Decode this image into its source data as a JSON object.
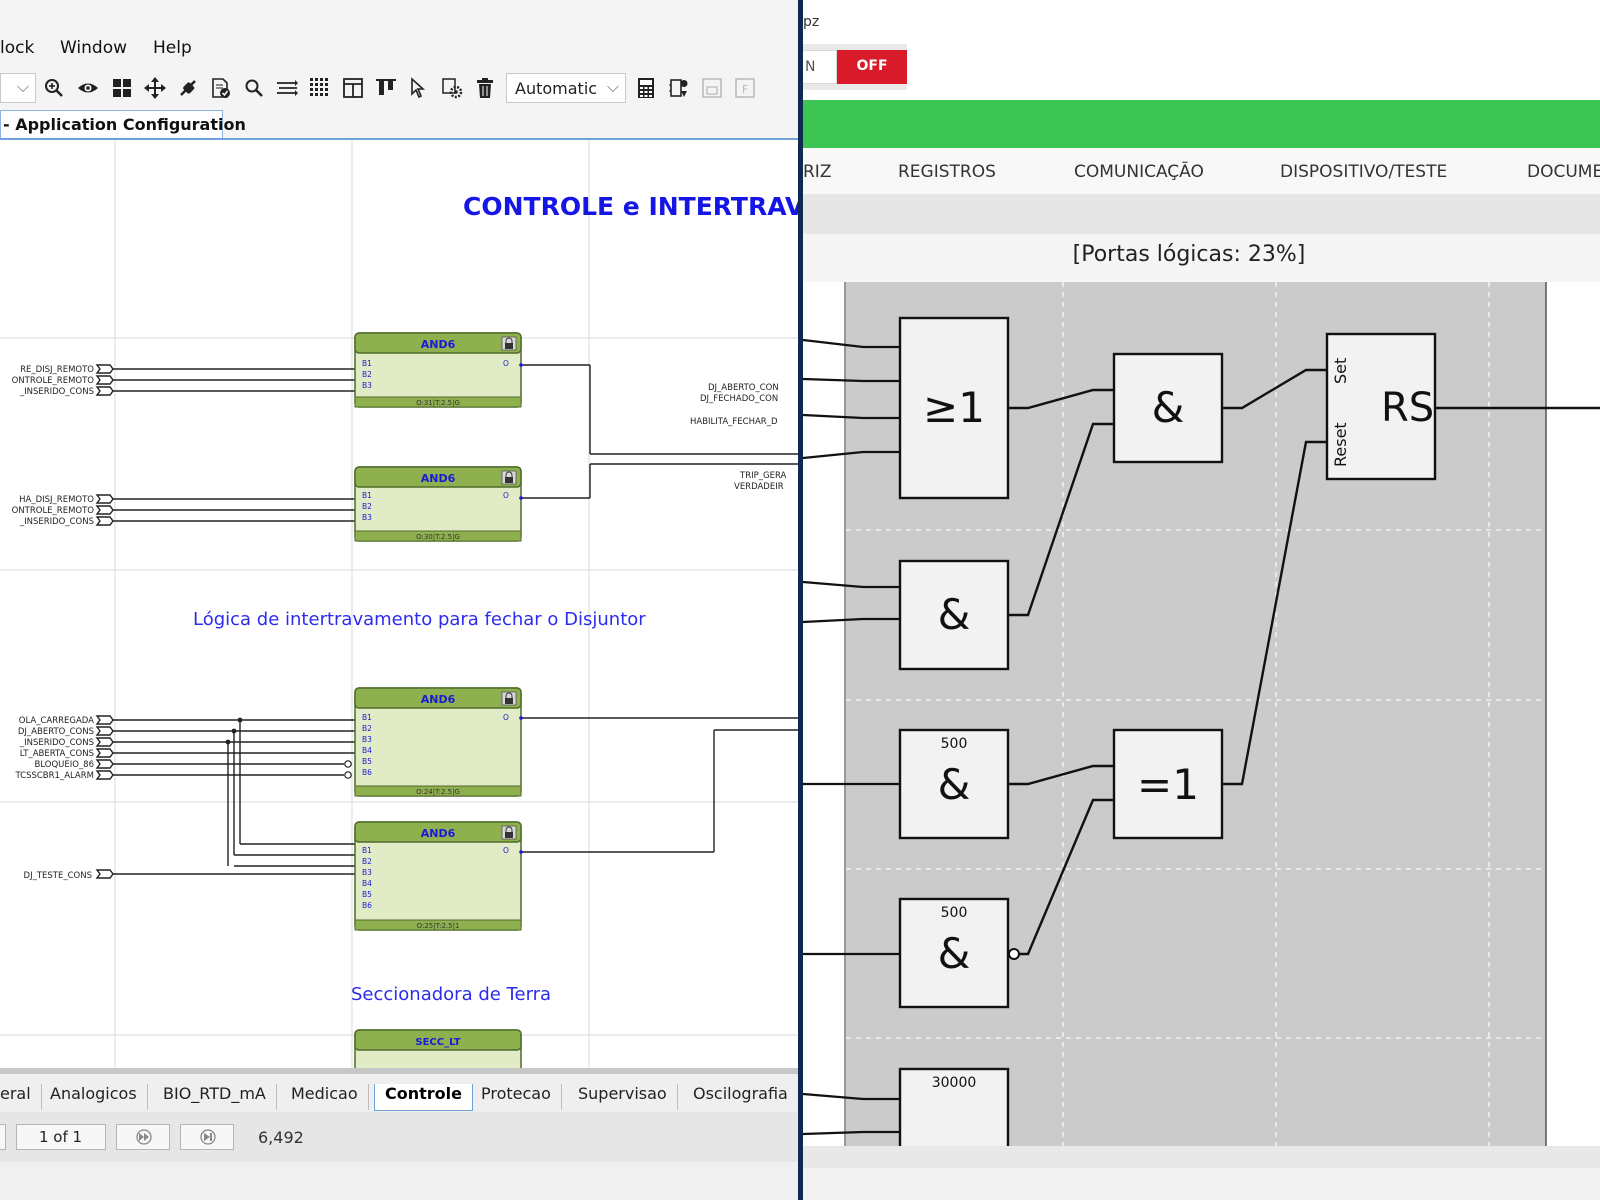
{
  "left": {
    "menu": {
      "items": [
        "lock",
        "Window",
        "Help"
      ]
    },
    "toolbar": {
      "zoom_mode": "Automatic"
    },
    "doc_tab": {
      "title": "- Application Configuration"
    },
    "canvas": {
      "heading": "CONTROLE e INTERTRAV",
      "caption_interlock": "Lógica de intertravamento para fechar o Disjuntor",
      "caption_ground": "Seccionadora de Terra",
      "inputs_g1": [
        "RE_DISJ_REMOTO",
        "ONTROLE_REMOTO",
        "_INSERIDO_CONS"
      ],
      "inputs_g2": [
        "HA_DISJ_REMOTO",
        "ONTROLE_REMOTO",
        "_INSERIDO_CONS"
      ],
      "inputs_g3": [
        "OLA_CARREGADA",
        "DJ_ABERTO_CONS",
        "_INSERIDO_CONS",
        "LT_ABERTA_CONS",
        "BLOQUEIO_86",
        "TCSSCBR1_ALARM"
      ],
      "inputs_g4": [
        "DJ_TESTE_CONS"
      ],
      "outputs_g1": [
        "DJ_ABERTO_CON",
        "DJ_FECHADO_CON",
        "HABILITA_FECHAR_D"
      ],
      "outputs_g2": [
        "TRIP_GERA",
        "VERDADEIR"
      ],
      "blocks": [
        {
          "type": "AND6",
          "ports": [
            "B1",
            "B2",
            "B3"
          ],
          "output": "O",
          "footer": "O:31|T:2.5|G"
        },
        {
          "type": "AND6",
          "ports": [
            "B1",
            "B2",
            "B3"
          ],
          "output": "O",
          "footer": "O:30|T:2.5|G"
        },
        {
          "type": "AND6",
          "ports": [
            "B1",
            "B2",
            "B3",
            "B4",
            "B5",
            "B6"
          ],
          "output": "O",
          "footer": "O:24|T:2.5|G"
        },
        {
          "type": "AND6",
          "ports": [
            "B1",
            "B2",
            "B3",
            "B4",
            "B5",
            "B6"
          ],
          "output": "O",
          "footer": "O:25|T:2.5|1"
        },
        {
          "type": "SECC_LT"
        }
      ]
    },
    "sheet_tabs": [
      {
        "label": "eral",
        "active": false
      },
      {
        "label": "Analogicos",
        "active": false
      },
      {
        "label": "BIO_RTD_mA",
        "active": false
      },
      {
        "label": "Medicao",
        "active": false
      },
      {
        "label": "Controle",
        "active": true
      },
      {
        "label": "Protecao",
        "active": false
      },
      {
        "label": "Supervisao",
        "active": false
      },
      {
        "label": "Oscilografia",
        "active": false
      }
    ],
    "status": {
      "page": "1 of 1",
      "coordinate": "6,492"
    }
  },
  "right": {
    "title_fragment": "pz",
    "toggle": {
      "on_label": "N",
      "off_label": "OFF"
    },
    "colors": {
      "green_bar": "#3cc553",
      "off_button": "#d91a2a"
    },
    "nav": [
      "RIZ",
      "REGISTROS",
      "COMUNICAÇÃO",
      "DISPOSITIVO/TESTE",
      "DOCUME"
    ],
    "subtitle": "[Portas lógicas: 23%]",
    "gates": [
      {
        "symbol": "≥1",
        "delay": ""
      },
      {
        "symbol": "&",
        "delay": ""
      },
      {
        "symbol": "&",
        "delay": ""
      },
      {
        "symbol": "&",
        "delay": "500"
      },
      {
        "symbol": "=1",
        "delay": ""
      },
      {
        "symbol": "&",
        "delay": "500"
      },
      {
        "symbol": "",
        "delay": "30000"
      }
    ],
    "rs_block": {
      "symbol": "RS",
      "set_label": "Set",
      "reset_label": "Reset"
    }
  }
}
